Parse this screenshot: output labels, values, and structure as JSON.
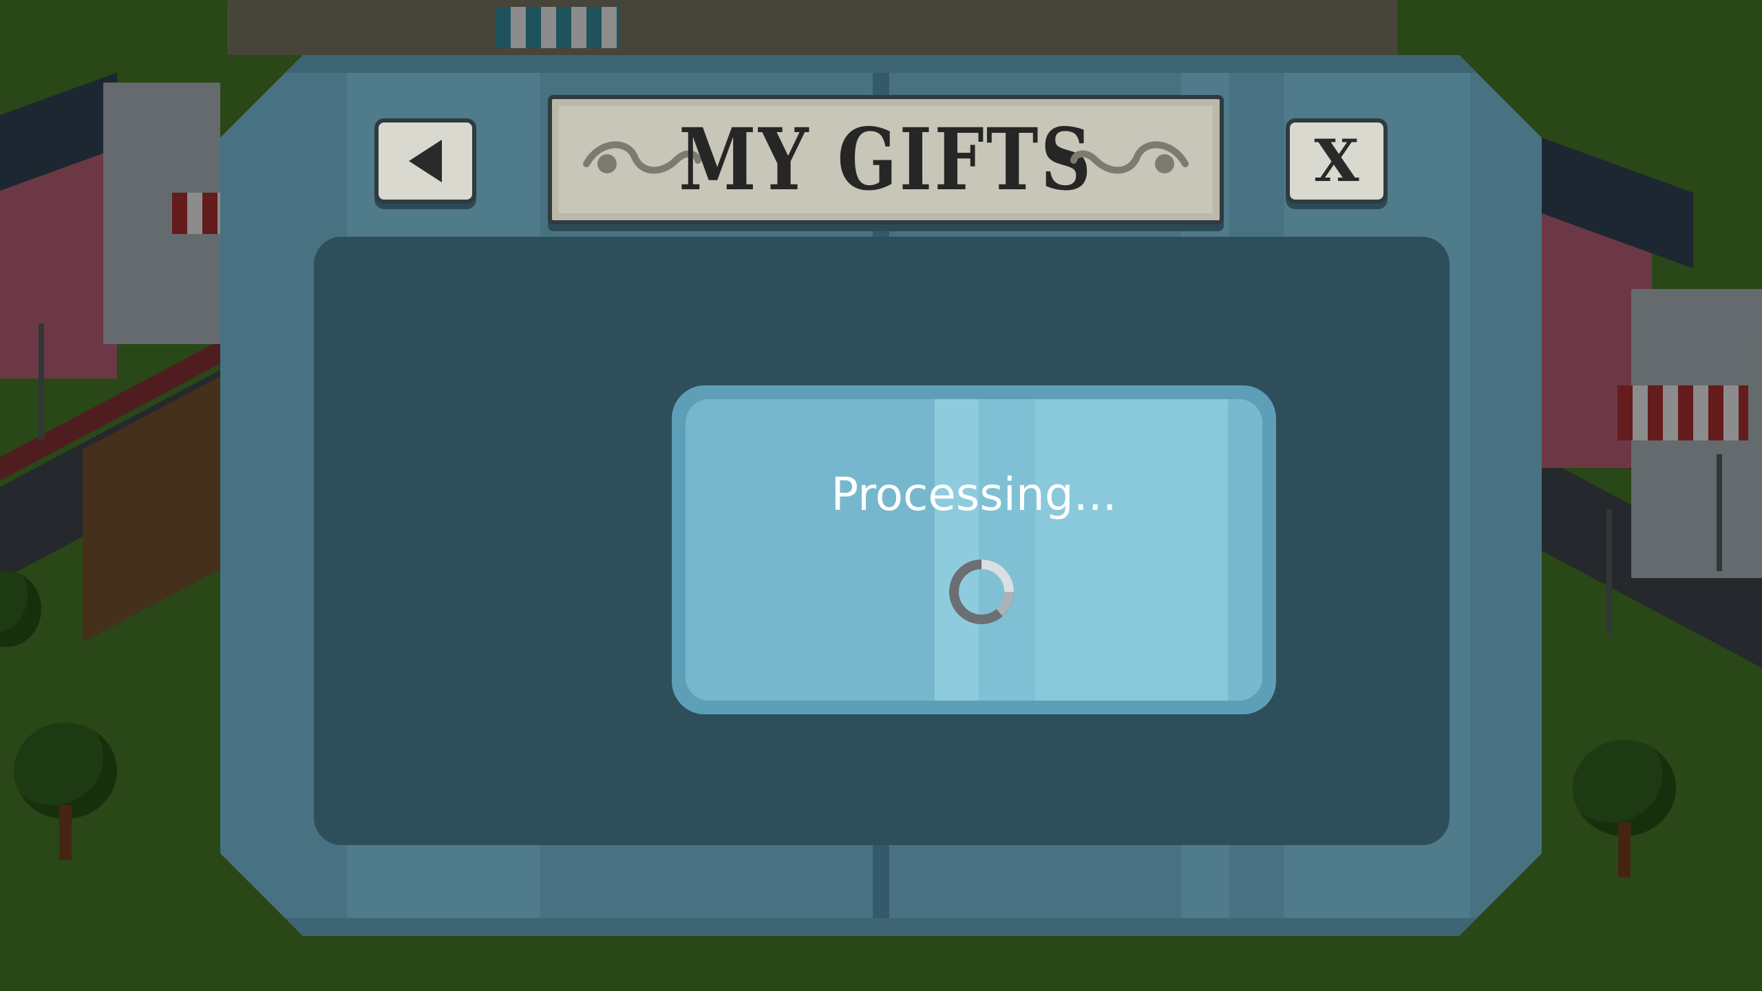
{
  "dialog": {
    "title": "MY GIFTS",
    "back_icon": "back-arrow-icon",
    "close_label": "X",
    "close_icon": "close-icon"
  },
  "status": {
    "message": "Processing...",
    "spinner_icon": "loading-spinner-icon"
  },
  "colors": {
    "dialog_frame": "#487282",
    "content_panel": "#2d4e5a",
    "processing_box": "#77b7cd",
    "text": "#ffffff"
  }
}
